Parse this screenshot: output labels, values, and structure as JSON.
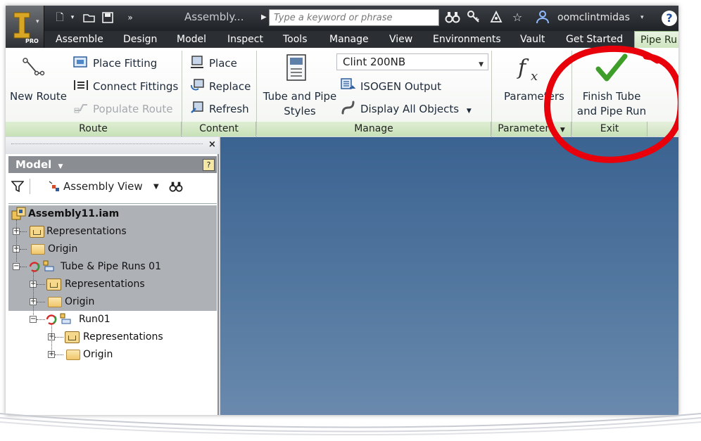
{
  "titlebar": {
    "document_title": "Assembly...",
    "search_placeholder": "Type a keyword or phrase",
    "user_name": "oomclintmidas",
    "app_badge": "PRO",
    "help_label": "?"
  },
  "tabs": [
    {
      "label": "Assemble"
    },
    {
      "label": "Design"
    },
    {
      "label": "Model"
    },
    {
      "label": "Inspect"
    },
    {
      "label": "Tools"
    },
    {
      "label": "Manage"
    },
    {
      "label": "View"
    },
    {
      "label": "Environments"
    },
    {
      "label": "Vault"
    },
    {
      "label": "Get Started"
    },
    {
      "label": "Pipe Ru",
      "active": true
    }
  ],
  "ribbon": {
    "route": {
      "group_label": "Route",
      "new_route": "New Route",
      "place_fitting": "Place Fitting",
      "connect_fittings": "Connect Fittings",
      "populate_route": "Populate Route"
    },
    "content": {
      "group_label": "Content",
      "place": "Place",
      "replace": "Replace",
      "refresh": "Refresh"
    },
    "manage": {
      "group_label": "Manage",
      "tube_and_pipe_styles_line1": "Tube and Pipe",
      "tube_and_pipe_styles_line2": "Styles",
      "style_selected": "Clint 200NB",
      "isogen_output": "ISOGEN Output",
      "display_all_objects": "Display All Objects"
    },
    "parameters": {
      "group_label": "Parameters",
      "parameters": "Parameters"
    },
    "exit": {
      "group_label": "Exit",
      "finish_line1": "Finish Tube",
      "finish_line2": "and Pipe Run"
    }
  },
  "browser": {
    "title": "Model",
    "view_label": "Assembly View",
    "close_label": "×",
    "help_label": "?",
    "tree": [
      {
        "label": "Assembly11.iam",
        "level": 0,
        "icon": "assembly-icon",
        "shaded": true,
        "bold": true
      },
      {
        "label": "Representations",
        "level": 1,
        "icon": "representations-icon",
        "shaded": true
      },
      {
        "label": "Origin",
        "level": 1,
        "icon": "folder-icon",
        "shaded": true
      },
      {
        "label": "Tube & Pipe Runs 01",
        "level": 1,
        "icon": "pipe-runs-icon",
        "shaded": true,
        "expanded": true
      },
      {
        "label": "Representations",
        "level": 2,
        "icon": "representations-icon",
        "shaded": true
      },
      {
        "label": "Origin",
        "level": 2,
        "icon": "folder-icon",
        "shaded": true
      },
      {
        "label": "Run01",
        "level": 2,
        "icon": "run-icon",
        "shaded": false,
        "expanded": true
      },
      {
        "label": "Representations",
        "level": 3,
        "icon": "representations-icon",
        "shaded": false
      },
      {
        "label": "Origin",
        "level": 3,
        "icon": "folder-icon",
        "shaded": false
      }
    ]
  },
  "colors": {
    "ribbon_active_tab": "#cfe5c0",
    "viewport_top": "#3b6391",
    "annotation_circle": "#e8000b",
    "finish_check": "#3f9e2a"
  }
}
